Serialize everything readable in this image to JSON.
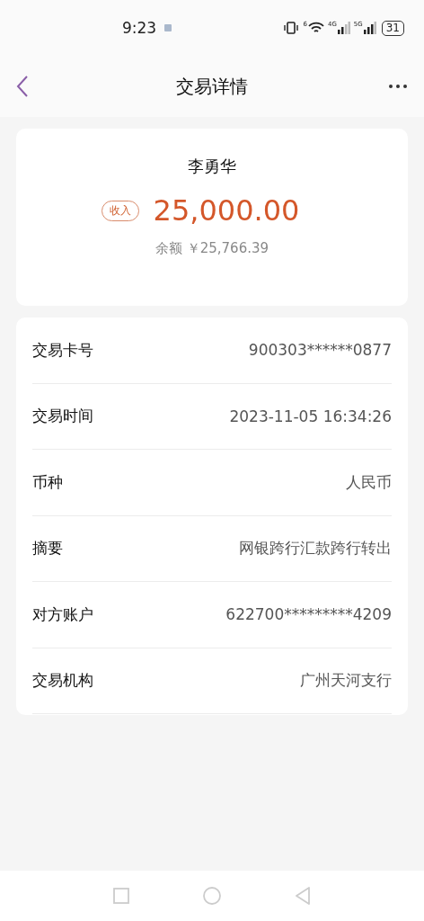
{
  "status_bar": {
    "time": "9:23",
    "wifi_label": "6",
    "sim1_label": "4G",
    "sim2_label": "5G",
    "battery": "31"
  },
  "header": {
    "title": "交易详情"
  },
  "summary": {
    "name": "李勇华",
    "tag": "收入",
    "amount": "25,000.00",
    "balance": "余额 ￥25,766.39"
  },
  "details": [
    {
      "label": "交易卡号",
      "value": "900303******0877"
    },
    {
      "label": "交易时间",
      "value": "2023-11-05 16:34:26"
    },
    {
      "label": "币种",
      "value": "人民币"
    },
    {
      "label": "摘要",
      "value": "网银跨行汇款跨行转出"
    },
    {
      "label": "对方账户",
      "value": "622700*********4209"
    },
    {
      "label": "交易机构",
      "value": "广州天河支行"
    }
  ]
}
